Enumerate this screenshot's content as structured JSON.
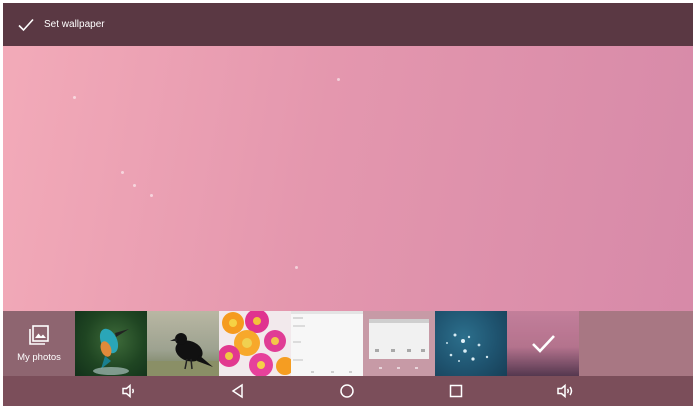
{
  "action_bar": {
    "set_wallpaper_label": "Set wallpaper",
    "icon": "check-icon"
  },
  "preview": {
    "wallpaper_colors": [
      "#f3abb9",
      "#e497ae",
      "#d689a8"
    ]
  },
  "thumb_strip": {
    "my_photos_label": "My photos",
    "my_photos_icon": "photo-gallery-icon",
    "thumbnails": [
      {
        "name": "thumb-kingfisher",
        "selected": false
      },
      {
        "name": "thumb-crow",
        "selected": false
      },
      {
        "name": "thumb-pink-flowers",
        "selected": false
      },
      {
        "name": "thumb-screenshot",
        "selected": false
      },
      {
        "name": "thumb-blue-splash",
        "selected": false
      },
      {
        "name": "thumb-pink-gradient",
        "selected": true
      }
    ]
  },
  "nav_bar": {
    "icons": [
      "volume-down-icon",
      "back-icon",
      "home-icon",
      "recents-icon",
      "volume-up-icon"
    ]
  },
  "colors": {
    "action_bar": "#5a3843",
    "thumb_strip": "#a87783",
    "nav_bar": "#7b4e5a"
  }
}
